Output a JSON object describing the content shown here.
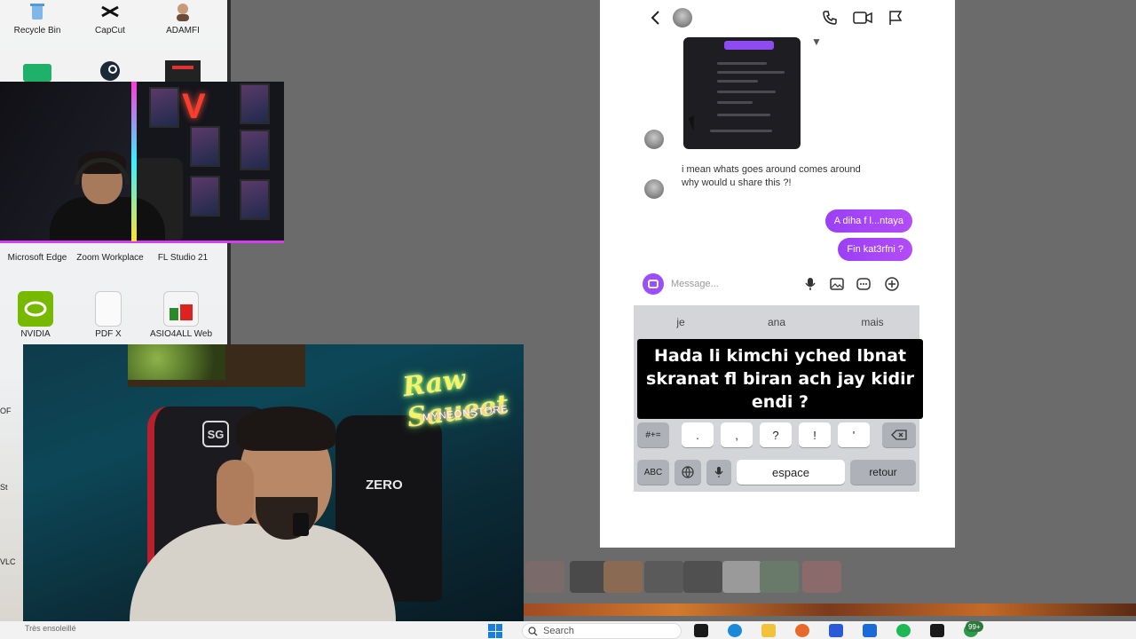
{
  "desktop": {
    "icons_top": [
      "Recycle Bin",
      "CapCut",
      "ADAMFI"
    ],
    "icons_middle": [
      "Microsoft Edge",
      "Zoom Workplace",
      "FL Studio 21"
    ],
    "icons_lower": [
      "NVIDIA",
      "PDF X",
      "ASIO4ALL Web"
    ],
    "partial_labels": [
      "OF",
      "St",
      "VLC"
    ]
  },
  "stream": {
    "neon_sign": "Raw Saueet",
    "neon_sub": "MYNEONSTORE",
    "chair_brand": "ZERO",
    "chair_logo": "SG"
  },
  "dm": {
    "incoming_message": "i mean whats goes around comes around why would u share this ?!",
    "outgoing_messages": [
      "A diha f l...ntaya",
      "Fin kat3rfni ?"
    ],
    "composer": {
      "placeholder": "Message..."
    }
  },
  "keyboard": {
    "suggestions": [
      "je",
      "ana",
      "mais"
    ],
    "symbol_key": "#+=",
    "punctuation_keys": [
      ".",
      ",",
      "?",
      "!",
      "'"
    ],
    "abc_key": "ABC",
    "space_key": "espace",
    "return_key": "retour"
  },
  "caption": {
    "line1": "Hada li kimchi yched lbnat",
    "line2": "skranat fl biran ach jay kidir",
    "line3": "endi ?"
  },
  "taskbar": {
    "left_text": "Très ensoleillé",
    "search_label": "Search",
    "notification_badge": "99+"
  },
  "colors": {
    "accent_purple": "#9b4df6",
    "neon_pink": "#d53cf0",
    "taskbar_bg": "#f2f2f2"
  }
}
